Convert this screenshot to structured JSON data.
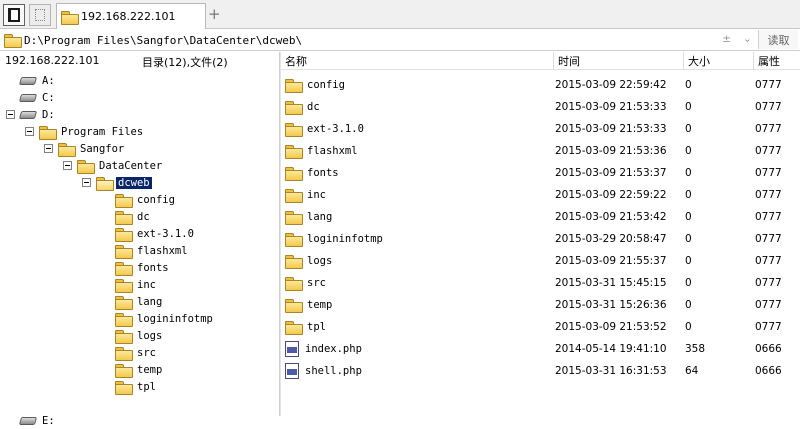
{
  "tab": {
    "title": "192.168.222.101",
    "add_label": "+"
  },
  "address": {
    "path": "D:\\Program Files\\Sangfor\\DataCenter\\dcweb\\",
    "controls": "± ⌄",
    "read_label": "读取"
  },
  "left": {
    "host": "192.168.222.101",
    "summary": "目录(12),文件(2)",
    "tree": [
      {
        "label": "A:",
        "kind": "drive",
        "depth": 0,
        "expander": false
      },
      {
        "label": "C:",
        "kind": "drive",
        "depth": 0,
        "expander": false
      },
      {
        "label": "D:",
        "kind": "drive",
        "depth": 0,
        "expander": true
      },
      {
        "label": "Program Files",
        "kind": "folder",
        "depth": 1,
        "expander": true
      },
      {
        "label": "Sangfor",
        "kind": "folder",
        "depth": 2,
        "expander": true
      },
      {
        "label": "DataCenter",
        "kind": "folder",
        "depth": 3,
        "expander": true
      },
      {
        "label": "dcweb",
        "kind": "folder-open",
        "depth": 4,
        "expander": true,
        "selected": true
      },
      {
        "label": "config",
        "kind": "folder",
        "depth": 5,
        "expander": false
      },
      {
        "label": "dc",
        "kind": "folder",
        "depth": 5,
        "expander": false
      },
      {
        "label": "ext-3.1.0",
        "kind": "folder",
        "depth": 5,
        "expander": false
      },
      {
        "label": "flashxml",
        "kind": "folder",
        "depth": 5,
        "expander": false
      },
      {
        "label": "fonts",
        "kind": "folder",
        "depth": 5,
        "expander": false
      },
      {
        "label": "inc",
        "kind": "folder",
        "depth": 5,
        "expander": false
      },
      {
        "label": "lang",
        "kind": "folder",
        "depth": 5,
        "expander": false
      },
      {
        "label": "logininfotmp",
        "kind": "folder",
        "depth": 5,
        "expander": false
      },
      {
        "label": "logs",
        "kind": "folder",
        "depth": 5,
        "expander": false
      },
      {
        "label": "src",
        "kind": "folder",
        "depth": 5,
        "expander": false
      },
      {
        "label": "temp",
        "kind": "folder",
        "depth": 5,
        "expander": false
      },
      {
        "label": "tpl",
        "kind": "folder",
        "depth": 5,
        "expander": false
      },
      {
        "label": "E:",
        "kind": "drive",
        "depth": 0,
        "expander": false,
        "gap": true
      }
    ]
  },
  "columns": {
    "name": "名称",
    "time": "时间",
    "size": "大小",
    "attr": "属性"
  },
  "files": [
    {
      "name": "config",
      "type": "folder",
      "time": "2015-03-09 22:59:42",
      "size": "0",
      "attr": "0777"
    },
    {
      "name": "dc",
      "type": "folder",
      "time": "2015-03-09 21:53:33",
      "size": "0",
      "attr": "0777"
    },
    {
      "name": "ext-3.1.0",
      "type": "folder",
      "time": "2015-03-09 21:53:33",
      "size": "0",
      "attr": "0777"
    },
    {
      "name": "flashxml",
      "type": "folder",
      "time": "2015-03-09 21:53:36",
      "size": "0",
      "attr": "0777"
    },
    {
      "name": "fonts",
      "type": "folder",
      "time": "2015-03-09 21:53:37",
      "size": "0",
      "attr": "0777"
    },
    {
      "name": "inc",
      "type": "folder",
      "time": "2015-03-09 22:59:22",
      "size": "0",
      "attr": "0777"
    },
    {
      "name": "lang",
      "type": "folder",
      "time": "2015-03-09 21:53:42",
      "size": "0",
      "attr": "0777"
    },
    {
      "name": "logininfotmp",
      "type": "folder",
      "time": "2015-03-29 20:58:47",
      "size": "0",
      "attr": "0777"
    },
    {
      "name": "logs",
      "type": "folder",
      "time": "2015-03-09 21:55:37",
      "size": "0",
      "attr": "0777"
    },
    {
      "name": "src",
      "type": "folder",
      "time": "2015-03-31 15:45:15",
      "size": "0",
      "attr": "0777"
    },
    {
      "name": "temp",
      "type": "folder",
      "time": "2015-03-31 15:26:36",
      "size": "0",
      "attr": "0777"
    },
    {
      "name": "tpl",
      "type": "folder",
      "time": "2015-03-09 21:53:52",
      "size": "0",
      "attr": "0777"
    },
    {
      "name": "index.php",
      "type": "php",
      "time": "2014-05-14 19:41:10",
      "size": "358",
      "attr": "0666"
    },
    {
      "name": "shell.php",
      "type": "php",
      "time": "2015-03-31 16:31:53",
      "size": "64",
      "attr": "0666"
    }
  ]
}
